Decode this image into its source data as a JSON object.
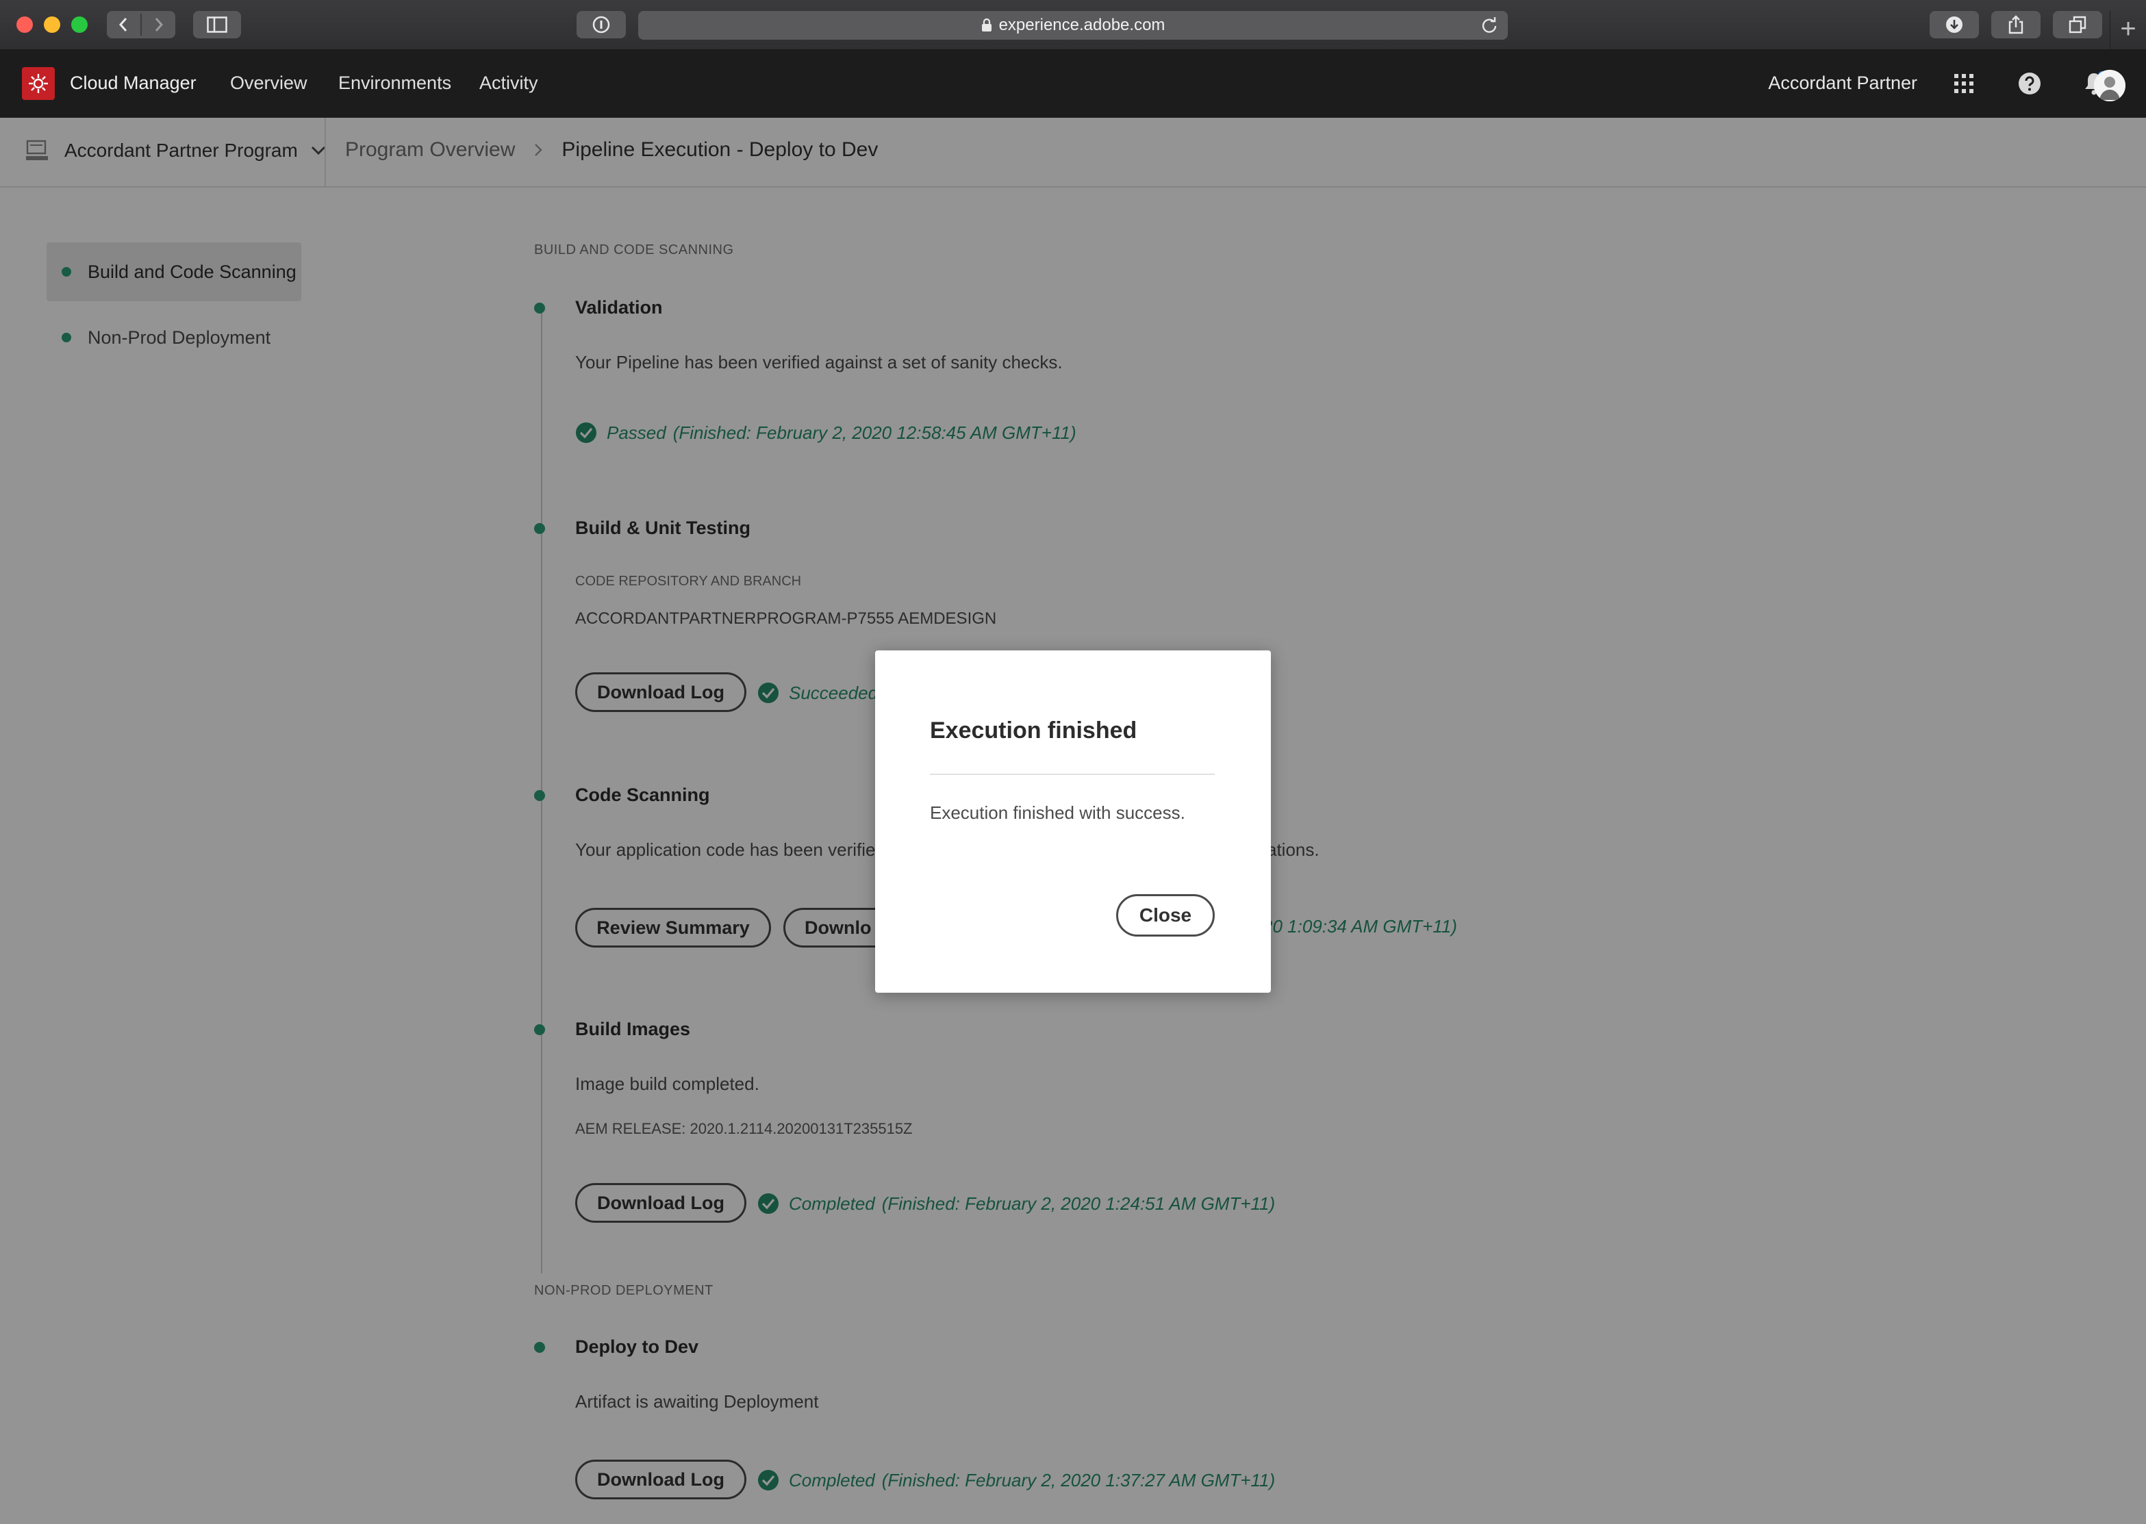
{
  "browser": {
    "url": "experience.adobe.com"
  },
  "header": {
    "app_name": "Cloud Manager",
    "nav": [
      "Overview",
      "Environments",
      "Activity"
    ],
    "org_name": "Accordant Partner",
    "brand_color": "#c42026"
  },
  "subheader": {
    "program": "Accordant Partner Program",
    "breadcrumb": [
      "Program Overview",
      "Pipeline Execution - Deploy to Dev"
    ]
  },
  "sidebar": {
    "items": [
      {
        "label": "Build and Code Scanning",
        "active": true
      },
      {
        "label": "Non-Prod Deployment",
        "active": false
      }
    ]
  },
  "main": {
    "section1": "BUILD AND CODE SCANNING",
    "validation": {
      "title": "Validation",
      "text": "Your Pipeline has been verified against a set of sanity checks.",
      "status": "Passed",
      "finished": "(Finished: February 2, 2020 12:58:45 AM GMT+11)"
    },
    "build": {
      "title": "Build & Unit Testing",
      "repo_label": "CODE REPOSITORY AND BRANCH",
      "repo_value": "ACCORDANTPARTNERPROGRAM-P7555 AEMDESIGN",
      "download": "Download Log",
      "status": "Succeeded",
      "finished_partial": "("
    },
    "scan": {
      "title": "Code Scanning",
      "text_left": "Your application code has been verified",
      "text_right": "ations.",
      "review": "Review Summary",
      "download_partial": "Downlo",
      "finished_partial": "20 1:09:34 AM GMT+11)"
    },
    "images": {
      "title": "Build Images",
      "text": "Image build completed.",
      "release": "AEM RELEASE: 2020.1.2114.20200131T235515Z",
      "download": "Download Log",
      "status": "Completed",
      "finished": "(Finished: February 2, 2020 1:24:51 AM GMT+11)"
    },
    "section2": "NON-PROD DEPLOYMENT",
    "deploy": {
      "title": "Deploy to Dev",
      "text": "Artifact is awaiting Deployment",
      "download": "Download Log",
      "status": "Completed",
      "finished": "(Finished: February 2, 2020 1:37:27 AM GMT+11)"
    },
    "success_color": "#268e6c"
  },
  "dialog": {
    "title": "Execution finished",
    "body": "Execution finished with success.",
    "close": "Close"
  }
}
